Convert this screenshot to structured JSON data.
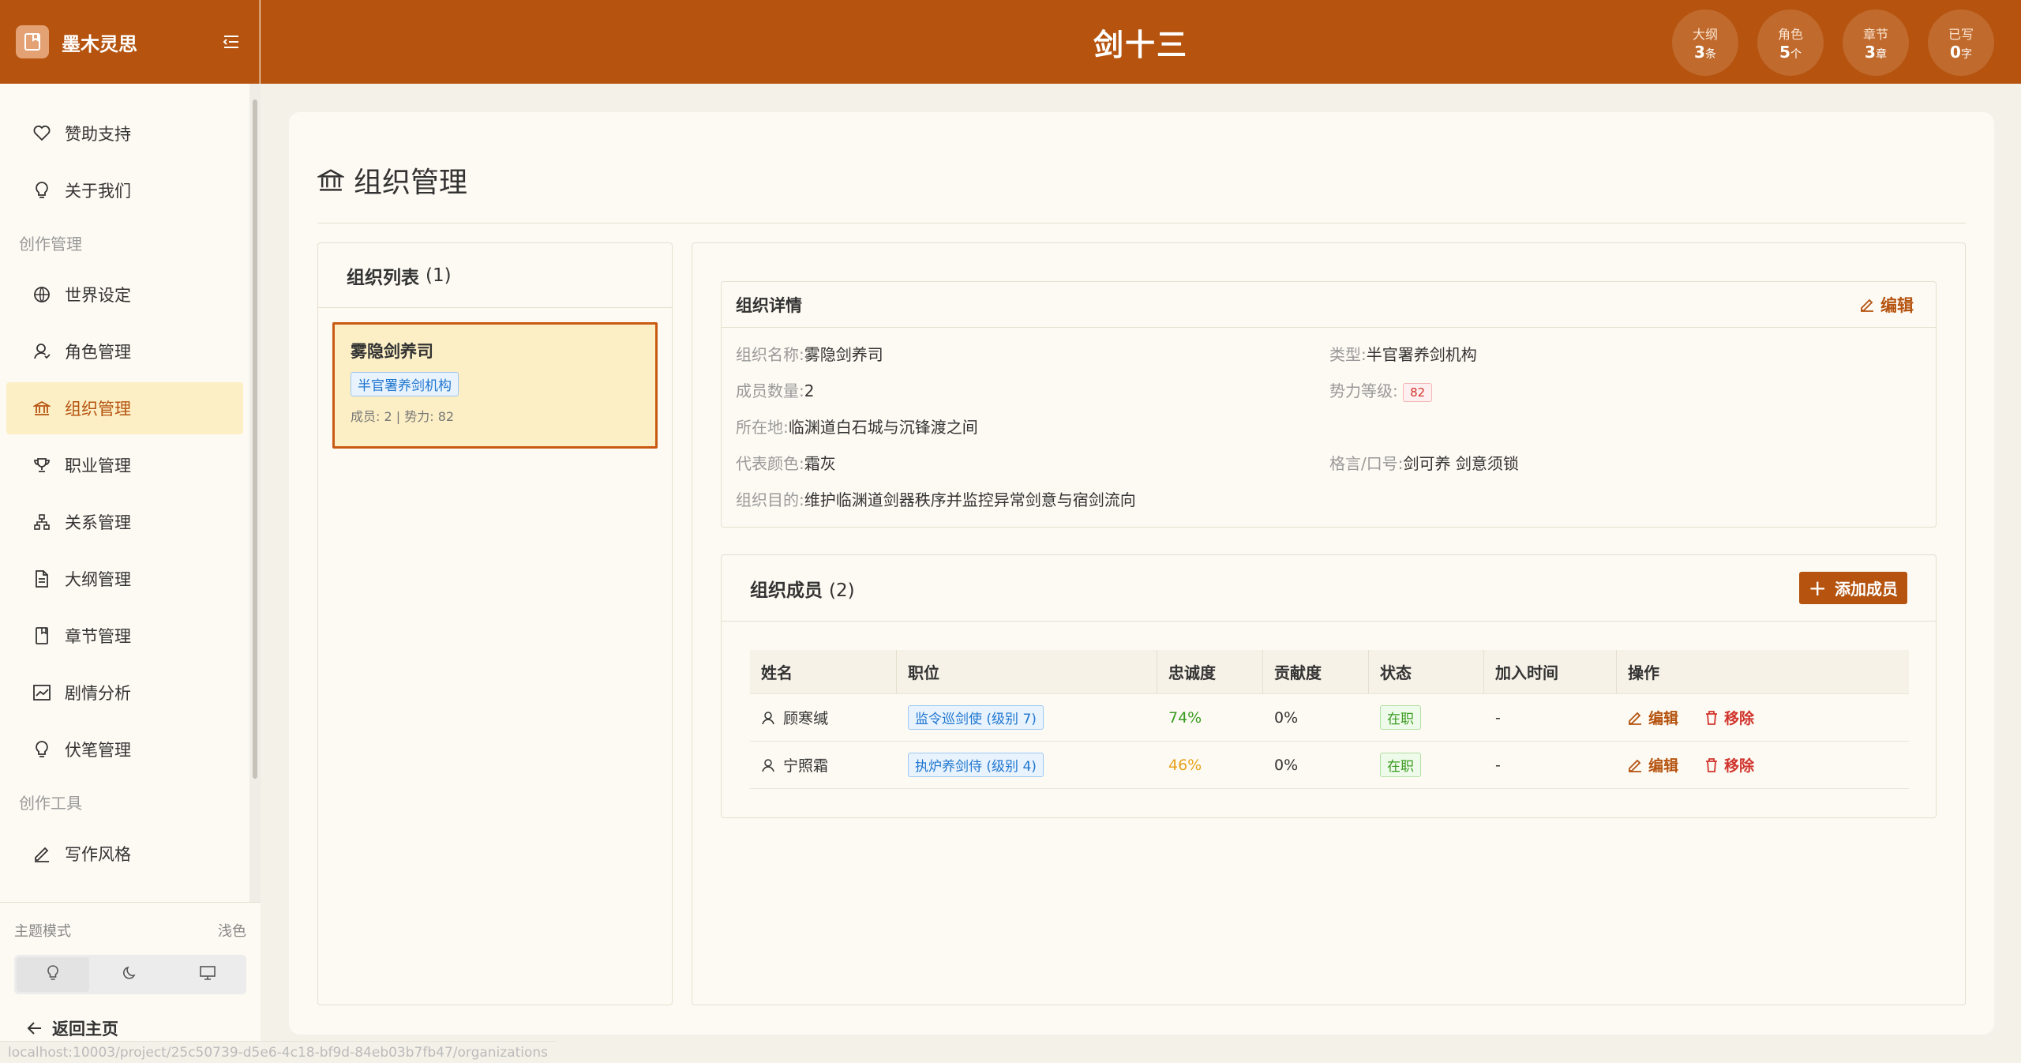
{
  "sidebar": {
    "brand": "墨木灵思",
    "items_top": [
      {
        "label": "赞助支持",
        "icon": "heart-icon"
      },
      {
        "label": "关于我们",
        "icon": "lightbulb-icon"
      }
    ],
    "section_create": "创作管理",
    "items_create": [
      {
        "label": "世界设定",
        "icon": "globe-icon"
      },
      {
        "label": "角色管理",
        "icon": "user-icon"
      },
      {
        "label": "组织管理",
        "icon": "bank-icon",
        "active": true
      },
      {
        "label": "职业管理",
        "icon": "trophy-icon"
      },
      {
        "label": "关系管理",
        "icon": "hierarchy-icon"
      },
      {
        "label": "大纲管理",
        "icon": "document-icon"
      },
      {
        "label": "章节管理",
        "icon": "book-icon"
      },
      {
        "label": "剧情分析",
        "icon": "chart-icon"
      },
      {
        "label": "伏笔管理",
        "icon": "lightbulb-icon"
      }
    ],
    "section_tools": "创作工具",
    "items_tools": [
      {
        "label": "写作风格",
        "icon": "pen-icon"
      }
    ],
    "theme_label": "主题模式",
    "theme_value": "浅色",
    "theme_options": [
      "light-bulb-icon",
      "moon-icon",
      "monitor-icon"
    ],
    "back_home": "返回主页"
  },
  "header": {
    "title": "剑十三",
    "stats": [
      {
        "label": "大纲",
        "value": "3",
        "unit": "条"
      },
      {
        "label": "角色",
        "value": "5",
        "unit": "个"
      },
      {
        "label": "章节",
        "value": "3",
        "unit": "章"
      },
      {
        "label": "已写",
        "value": "0",
        "unit": "字"
      }
    ]
  },
  "page": {
    "title": "组织管理"
  },
  "org_list": {
    "title": "组织列表",
    "count": "(1)",
    "items": [
      {
        "name": "雾隐剑养司",
        "type": "半官署养剑机构",
        "meta": "成员: 2 | 势力: 82"
      }
    ]
  },
  "detail": {
    "title": "组织详情",
    "edit_label": "编辑",
    "fields": {
      "name_k": "组织名称:",
      "name_v": "雾隐剑养司",
      "type_k": "类型:",
      "type_v": "半官署养剑机构",
      "members_k": "成员数量:",
      "members_v": "2",
      "power_k": "势力等级:",
      "power_v": "82",
      "location_k": "所在地:",
      "location_v": "临渊道白石城与沉锋渡之间",
      "color_k": "代表颜色:",
      "color_v": "霜灰",
      "motto_k": "格言/口号:",
      "motto_v": "剑可养 剑意须锁",
      "goal_k": "组织目的:",
      "goal_v": "维护临渊道剑器秩序并监控异常剑意与宿剑流向"
    }
  },
  "members": {
    "title": "组织成员",
    "count": "(2)",
    "add_label": "添加成员",
    "columns": [
      "姓名",
      "职位",
      "忠诚度",
      "贡献度",
      "状态",
      "加入时间",
      "操作"
    ],
    "rows": [
      {
        "name": "顾寒缄",
        "position": "监令巡剑使 (级别 7)",
        "loyalty": "74%",
        "contribution": "0%",
        "status": "在职",
        "joined": "-"
      },
      {
        "name": "宁照霜",
        "position": "执炉养剑侍 (级别 4)",
        "loyalty": "46%",
        "contribution": "0%",
        "status": "在职",
        "joined": "-"
      }
    ],
    "edit_label": "编辑",
    "remove_label": "移除"
  },
  "status_bar": {
    "url": "localhost:10003/project/25c50739-d5e6-4c18-bf9d-84eb03b7fb47/organizations"
  },
  "colors": {
    "brand": "#b5530f",
    "active_bg": "#fcefc5",
    "page_bg": "#f4f1e9"
  }
}
